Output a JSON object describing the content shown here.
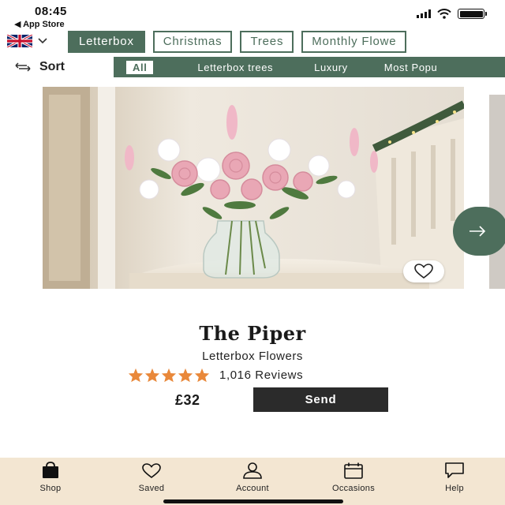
{
  "status_bar": {
    "time": "08:45",
    "back_label": "◀ App Store"
  },
  "category_tabs": [
    {
      "label": "Letterbox",
      "active": true
    },
    {
      "label": "Christmas",
      "active": false
    },
    {
      "label": "Trees",
      "active": false
    },
    {
      "label": "Monthly Flowe",
      "active": false
    }
  ],
  "sort": {
    "label": "Sort"
  },
  "sub_tabs": [
    {
      "label": "All",
      "active": true
    },
    {
      "label": "Letterbox trees",
      "active": false
    },
    {
      "label": "Luxury",
      "active": false
    },
    {
      "label": "Most Popu",
      "active": false
    }
  ],
  "product": {
    "name": "The Piper",
    "category": "Letterbox Flowers",
    "rating_stars": 5,
    "reviews": "1,016 Reviews",
    "price": "£32",
    "send_label": "Send",
    "image_icon": "flower-bouquet-photo"
  },
  "bottom_nav": [
    {
      "label": "Shop",
      "icon": "shopping-bag-icon"
    },
    {
      "label": "Saved",
      "icon": "heart-icon"
    },
    {
      "label": "Account",
      "icon": "person-icon"
    },
    {
      "label": "Occasions",
      "icon": "calendar-icon"
    },
    {
      "label": "Help",
      "icon": "chat-bubble-icon"
    }
  ],
  "colors": {
    "brand_green": "#4d6e5c",
    "star_orange": "#e9883a",
    "nav_background": "#f3e6d2",
    "send_button": "#2b2b2b"
  }
}
